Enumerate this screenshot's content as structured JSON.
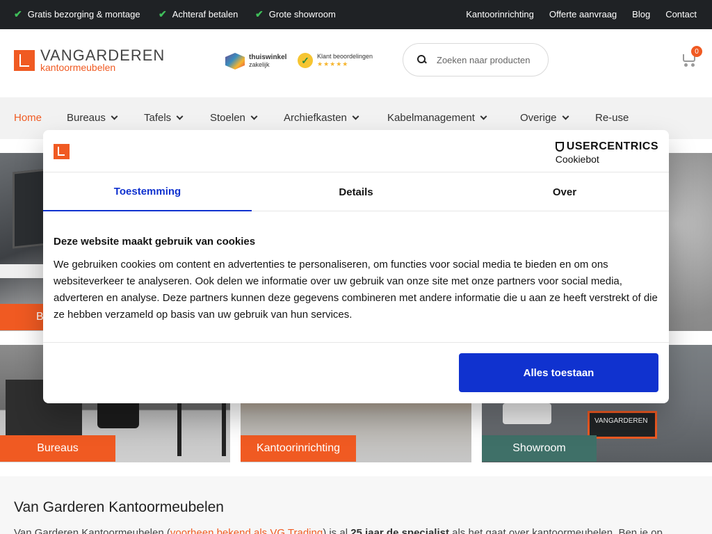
{
  "topbar": {
    "usps": [
      "Gratis bezorging & montage",
      "Achteraf betalen",
      "Grote showroom"
    ],
    "links": [
      "Kantoorinrichting",
      "Offerte aanvraag",
      "Blog",
      "Contact"
    ]
  },
  "header": {
    "logo_brand": "VANGARDEREN",
    "logo_sub": "kantoormeubelen",
    "badge_thuiswinkel": {
      "line1": "thuiswinkel",
      "line2": "zakelijk"
    },
    "badge_reviews": {
      "label": "Klant beoordelingen",
      "stars": "★★★★★"
    },
    "search_placeholder": "Zoeken naar producten",
    "cart_count": "0"
  },
  "nav": {
    "items": [
      {
        "label": "Home",
        "active": true
      },
      {
        "label": "Bureaus"
      },
      {
        "label": "Tafels"
      },
      {
        "label": "Stoelen"
      },
      {
        "label": "Archiefkasten"
      },
      {
        "label": "Kabelmanagement"
      },
      {
        "label": "Overige"
      },
      {
        "label": "Re-use"
      }
    ]
  },
  "tiles": {
    "top_left_label": "B",
    "bureaus": "Bureaus",
    "kantoorinrichting": "Kantoorinrichting",
    "showroom": "Showroom",
    "sign_text": "VANGARDEREN"
  },
  "about": {
    "title": "Van Garderen Kantoormeubelen",
    "text_start": "Van Garderen Kantoormeubelen (",
    "text_link": "voorheen bekend als VG Trading",
    "text_mid": ") is al ",
    "text_bold": "25 jaar de specialist",
    "text_end": " als het gaat over kantoormeubelen. Ben je op"
  },
  "cookie": {
    "provider_line1": "USERCENTRICS",
    "provider_line2": "Cookiebot",
    "tabs": [
      "Toestemming",
      "Details",
      "Over"
    ],
    "heading": "Deze website maakt gebruik van cookies",
    "body": "We gebruiken cookies om content en advertenties te personaliseren, om functies voor social media te bieden en om ons websiteverkeer te analyseren. Ook delen we informatie over uw gebruik van onze site met onze partners voor social media, adverteren en analyse. Deze partners kunnen deze gegevens combineren met andere informatie die u aan ze heeft verstrekt of die ze hebben verzameld op basis van uw gebruik van hun services.",
    "accept_button": "Alles toestaan"
  },
  "colors": {
    "brand_orange": "#f05a22",
    "cookie_blue": "#1032cf",
    "showroom_green": "#3f7068",
    "topbar_dark": "#1f2225",
    "check_green": "#3fbf5a"
  }
}
